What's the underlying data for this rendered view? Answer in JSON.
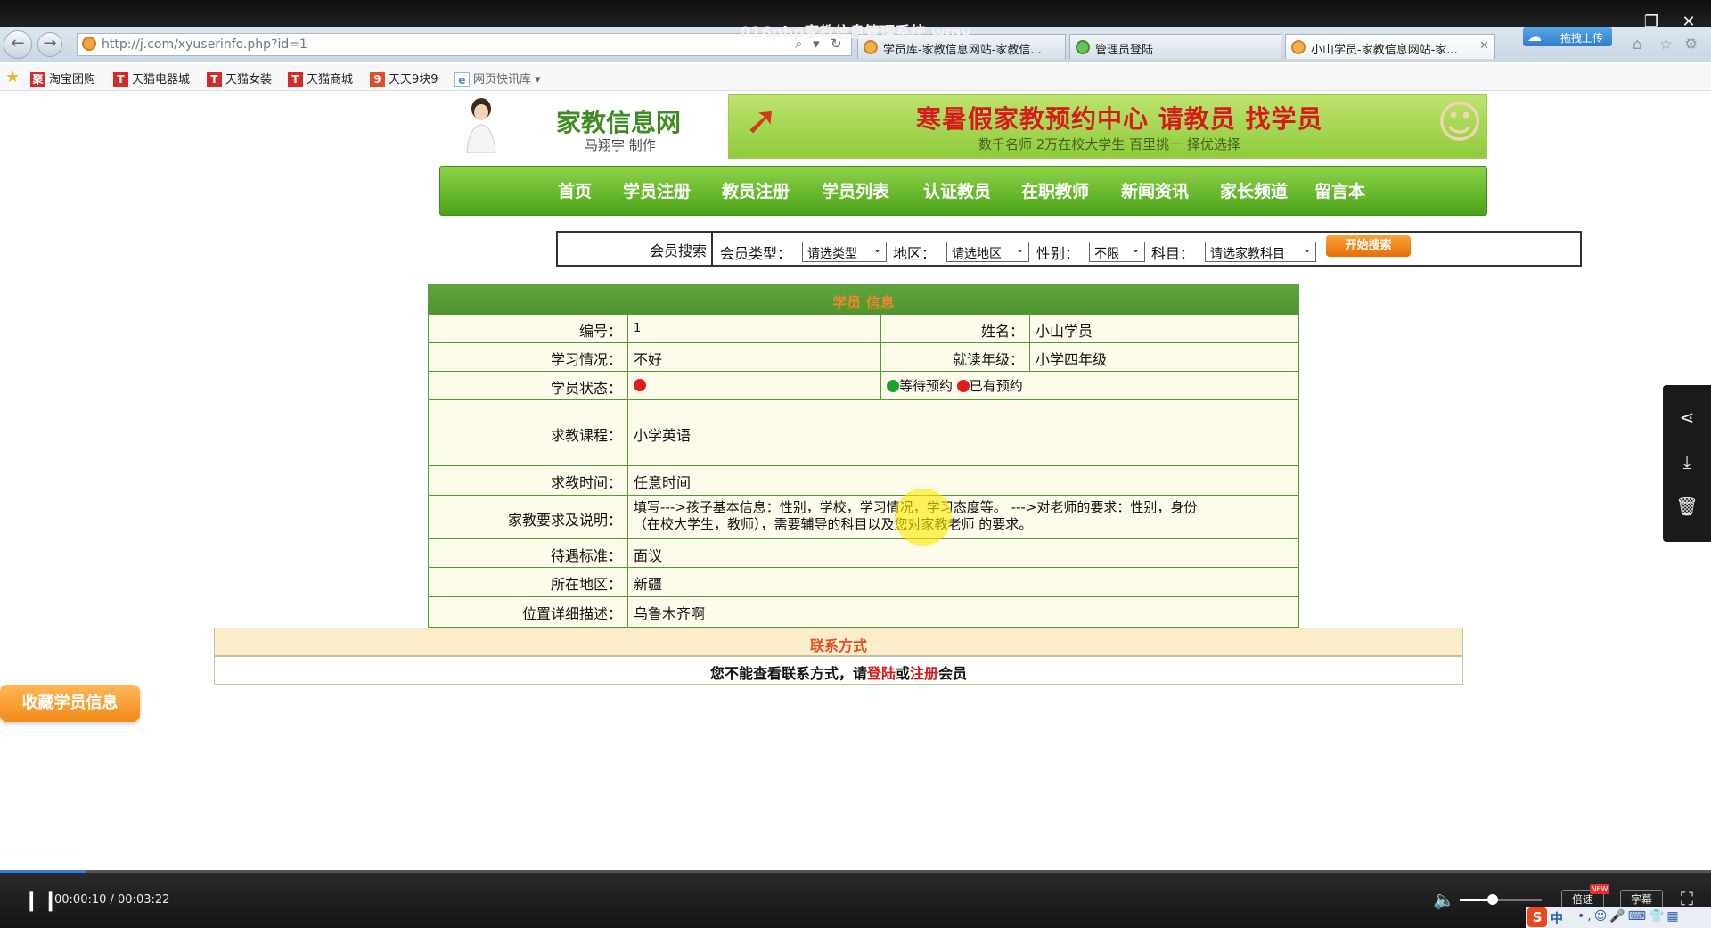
{
  "player": {
    "title": "016php家教信息管理系统.wmv",
    "time": "00:00:10 / 00:03:22",
    "progress": 0.05,
    "volume": 0.4,
    "speed_label": "倍速",
    "speed_badge": "NEW",
    "subtitle_label": "字幕"
  },
  "browser": {
    "url": "http://j.com/xyuserinfo.php?id=1",
    "tabs": [
      "学员库-家教信息网站-家教信...",
      "管理员登陆",
      "小山学员-家教信息网站-家..."
    ],
    "upload_label": "拖拽上传",
    "favorites": [
      "淘宝团购",
      "天猫电器城",
      "天猫女装",
      "天猫商城",
      "天天9块9",
      "网页快讯库"
    ]
  },
  "site": {
    "logo_title": "家教信息网",
    "logo_subtitle": "马翔宇 制作",
    "banner_main": "寒暑假家教预约中心 请教员 找学员",
    "banner_sub": "数千名师 2万在校大学生 百里挑一 择优选择",
    "nav": [
      "首页",
      "学员注册",
      "教员注册",
      "学员列表",
      "认证教员",
      "在职教师",
      "新闻资讯",
      "家长频道",
      "留言本"
    ]
  },
  "search": {
    "title": "会员搜索",
    "member_type_label": "会员类型：",
    "member_type_value": "请选类型",
    "region_label": "地区：",
    "region_value": "请选地区",
    "gender_label": "性别：",
    "gender_value": "不限",
    "subject_label": "科目：",
    "subject_value": "请选家教科目",
    "button": "开始搜索"
  },
  "detail": {
    "header": "学员 信息",
    "id_label": "编号：",
    "id_value": "1",
    "name_label": "姓名：",
    "name_value": "小山学员",
    "study_label": "学习情况：",
    "study_value": "不好",
    "grade_label": "就读年级：",
    "grade_value": "小学四年级",
    "status_label": "学员状态：",
    "status_dot_color": "#e31b1b",
    "legend_waiting": "等待预约",
    "legend_waiting_color": "#18a52b",
    "legend_booked": "已有预约",
    "legend_booked_color": "#e31b1b",
    "course_label": "求教课程：",
    "course_value": "小学英语",
    "time_label": "求教时间：",
    "time_value": "任意时间",
    "req_label": "家教要求及说明：",
    "req_line1": "填写--->孩子基本信息：性别，学校，学习情况，学习态度等。 --->对老师的要求：性别，身份",
    "req_line2": "（在校大学生，教师），需要辅导的科目以及您对家教老师 的要求。",
    "pay_label": "待遇标准：",
    "pay_value": "面议",
    "area_label": "所在地区：",
    "area_value": "新疆",
    "addr_label": "位置详细描述：",
    "addr_value": "乌鲁木齐啊"
  },
  "contact": {
    "title": "联系方式",
    "msg_pre": "您不能查看联系方式，请",
    "login": "登陆",
    "or": "或",
    "register": "注册",
    "msg_post": "会员"
  },
  "favorite_button": "收藏学员信息",
  "ime": {
    "label": "中"
  }
}
